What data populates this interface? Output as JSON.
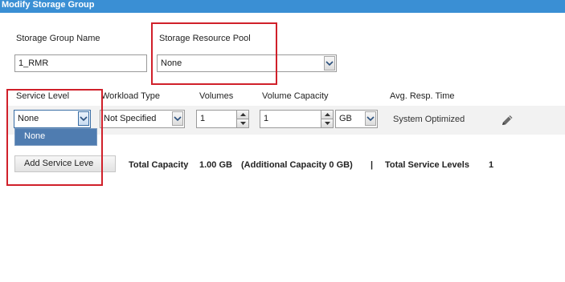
{
  "window": {
    "title": "Modify Storage Group"
  },
  "group_name": {
    "label": "Storage Group Name",
    "value": "1_RMR"
  },
  "resource_pool": {
    "label": "Storage Resource Pool",
    "value": "None"
  },
  "table": {
    "headers": {
      "service_level": "Service Level",
      "workload_type": "Workload Type",
      "volumes": "Volumes",
      "volume_capacity": "Volume Capacity",
      "avg_resp_time": "Avg. Resp. Time"
    },
    "row": {
      "service_level": "None",
      "workload_type": "Not Specified",
      "volumes": "1",
      "volume_capacity": "1",
      "capacity_unit": "GB",
      "avg_resp_time": "System Optimized"
    }
  },
  "service_level_dropdown": {
    "options": [
      "None"
    ]
  },
  "add_button": {
    "label": "Add Service Leve"
  },
  "summary": {
    "total_capacity_label": "Total Capacity",
    "total_capacity_value": "1.00 GB",
    "additional_capacity": "(Additional Capacity 0 GB)",
    "separator": "|",
    "total_service_levels_label": "Total Service Levels",
    "total_service_levels_value": "1"
  },
  "icons": {
    "edit": "pencil-icon",
    "dropdown": "chevron-down-icon",
    "spin_up": "triangle-up-icon",
    "spin_down": "triangle-down-icon"
  },
  "colors": {
    "title_bar": "#3a8fd4",
    "highlight_box": "#d0202a",
    "selected_option": "#4f7cb0"
  }
}
